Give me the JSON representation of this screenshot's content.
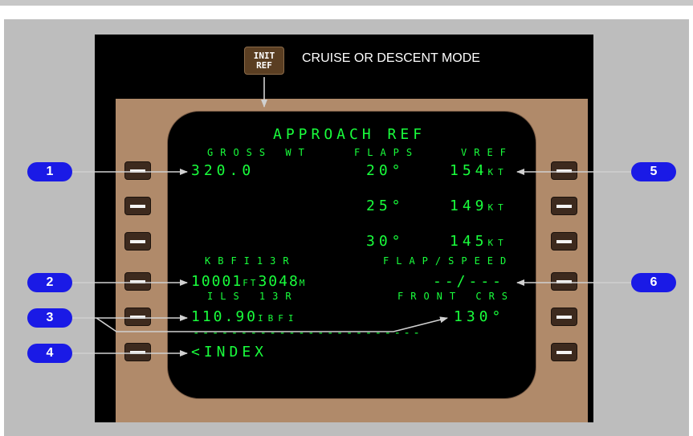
{
  "mode_label": "CRUISE OR DESCENT MODE",
  "init_ref_key": {
    "line1": "INIT",
    "line2": "REF"
  },
  "screen": {
    "title": "APPROACH REF",
    "gross_wt_label": "GROSS WT",
    "gross_wt_value": "320.0",
    "flaps_label": "FLAPS",
    "vref_label": "VREF",
    "rows": [
      {
        "flaps": "20°",
        "vref": "154",
        "unit": "KT"
      },
      {
        "flaps": "25°",
        "vref": "149",
        "unit": "KT"
      },
      {
        "flaps": "30°",
        "vref": "145",
        "unit": "KT"
      }
    ],
    "runway_label": "KBFI13R",
    "runway_length_ft": "10001",
    "ft_unit": "FT",
    "runway_length_m": "3048",
    "m_unit": "M",
    "flap_speed_label": "FLAP/SPEED",
    "flap_speed_value": "--/---",
    "ils_label": "ILS 13R",
    "ils_freq": "110.90",
    "ils_ident": "IBFI",
    "front_crs_label": "FRONT CRS",
    "front_crs_value": "130°",
    "dashes": "------------------------",
    "index": "<INDEX"
  },
  "callouts": [
    "1",
    "2",
    "3",
    "4",
    "5",
    "6"
  ],
  "colors": {
    "display_text": "#19ff3c",
    "callout": "#1a1ae6",
    "bezel": "#b08a6a"
  }
}
